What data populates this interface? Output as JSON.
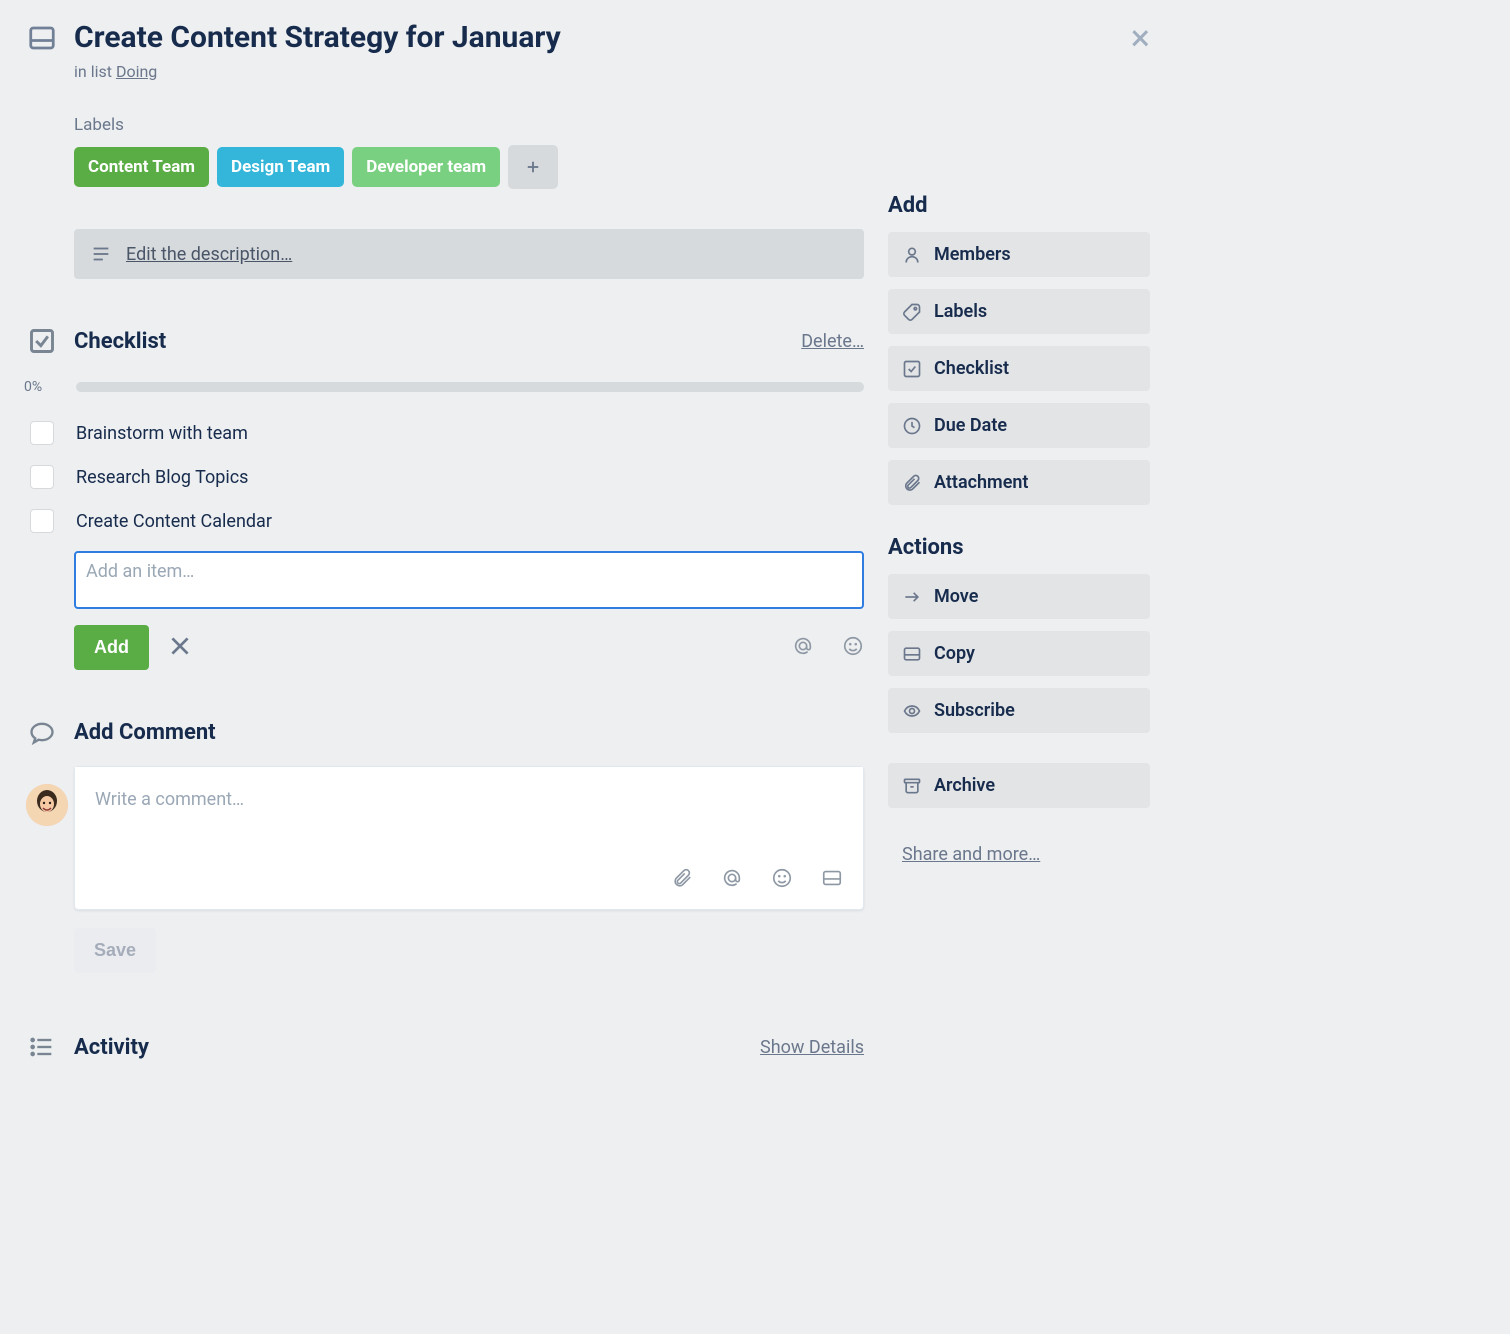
{
  "header": {
    "title": "Create Content Strategy for January",
    "in_list_prefix": "in list ",
    "list_name": "Doing"
  },
  "labels": {
    "heading": "Labels",
    "items": [
      {
        "text": "Content Team",
        "color": "label-green"
      },
      {
        "text": "Design Team",
        "color": "label-cyan"
      },
      {
        "text": "Developer team",
        "color": "label-lime"
      }
    ]
  },
  "description": {
    "edit_text": "Edit the description…"
  },
  "checklist": {
    "heading": "Checklist",
    "delete_link": "Delete…",
    "progress_pct": "0%",
    "items": [
      "Brainstorm with team",
      "Research Blog Topics",
      "Create Content Calendar"
    ],
    "add_placeholder": "Add an item…",
    "add_button": "Add"
  },
  "comment": {
    "heading": "Add Comment",
    "placeholder": "Write a comment…",
    "save_button": "Save"
  },
  "activity": {
    "heading": "Activity",
    "show_details": "Show Details"
  },
  "sidebar": {
    "add_heading": "Add",
    "add_items": [
      "Members",
      "Labels",
      "Checklist",
      "Due Date",
      "Attachment"
    ],
    "actions_heading": "Actions",
    "action_items": [
      "Move",
      "Copy",
      "Subscribe"
    ],
    "archive": "Archive",
    "share_link": "Share and more…"
  }
}
